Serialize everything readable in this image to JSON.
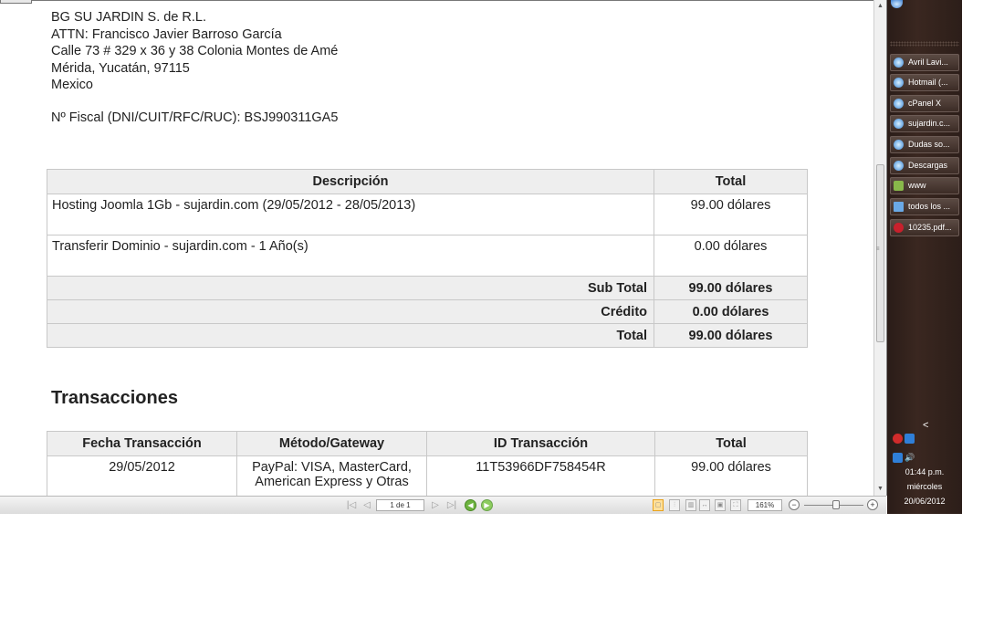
{
  "document": {
    "address_lines": [
      "BG SU JARDIN S. de R.L.",
      "ATTN: Francisco Javier Barroso García",
      "Calle 73 # 329 x 36 y 38 Colonia Montes de Amé",
      "Mérida, Yucatán, 97115",
      "Mexico"
    ],
    "fiscal": "Nº Fiscal (DNI/CUIT/RFC/RUC): BSJ990311GA5",
    "invoice": {
      "headers": {
        "description": "Descripción",
        "total": "Total"
      },
      "items": [
        {
          "description": "Hosting Joomla 1Gb - sujardin.com (29/05/2012 - 28/05/2013)",
          "amount": "99.00 dólares"
        },
        {
          "description": "Transferir Dominio - sujardin.com - 1 Año(s)",
          "amount": "0.00 dólares"
        }
      ],
      "totals": [
        {
          "label": "Sub Total",
          "value": "99.00 dólares"
        },
        {
          "label": "Crédito",
          "value": "0.00 dólares"
        },
        {
          "label": "Total",
          "value": "99.00 dólares"
        }
      ]
    },
    "transactions": {
      "title": "Transacciones",
      "headers": {
        "date": "Fecha Transacción",
        "method": "Método/Gateway",
        "id": "ID Transacción",
        "total": "Total"
      },
      "rows": [
        {
          "date": "29/05/2012",
          "method_line1": "PayPal: VISA, MasterCard,",
          "method_line2": "American Express y Otras",
          "id": "11T53966DF758454R",
          "total": "99.00 dólares"
        }
      ]
    }
  },
  "toolbar": {
    "page_indicator": "1 de 1",
    "zoom": "161%",
    "icons": [
      "first-page-icon",
      "prev-page-icon",
      "next-page-icon",
      "last-page-icon",
      "back-icon",
      "forward-icon"
    ]
  },
  "taskbar": {
    "items": [
      {
        "label": "Avril Lavi...",
        "icon": "browser-icon"
      },
      {
        "label": "Hotmail (...",
        "icon": "browser-icon"
      },
      {
        "label": "cPanel X",
        "icon": "browser-icon"
      },
      {
        "label": "sujardin.c...",
        "icon": "browser-icon"
      },
      {
        "label": "Dudas so...",
        "icon": "browser-icon"
      },
      {
        "label": "Descargas",
        "icon": "browser-icon"
      },
      {
        "label": "www",
        "icon": "folder-icon"
      },
      {
        "label": "todos los ...",
        "icon": "document-icon"
      },
      {
        "label": "10235.pdf...",
        "icon": "pdf-icon"
      }
    ],
    "clock": {
      "time": "01:44 p.m.",
      "day": "miércoles",
      "date": "20/06/2012"
    },
    "tray_chevron": "<"
  },
  "colors": {
    "taskbar_bg": "#3a2720",
    "header_bg": "#eeeeee",
    "nav_green": "#6db33f"
  }
}
